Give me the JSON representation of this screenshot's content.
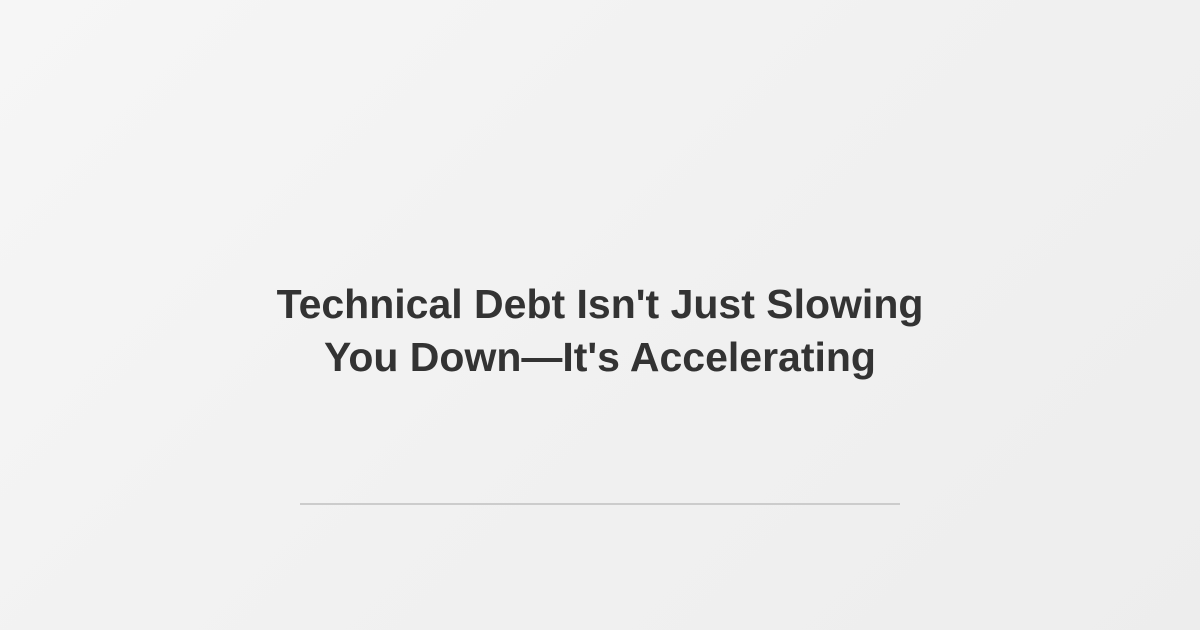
{
  "card": {
    "title_lines": [
      "Technical Debt Isn't Just Slowing",
      "You Down—It's Accelerating"
    ]
  },
  "colors": {
    "text": "#333333",
    "divider": "#cccccc",
    "background": "#f1f1f1"
  }
}
